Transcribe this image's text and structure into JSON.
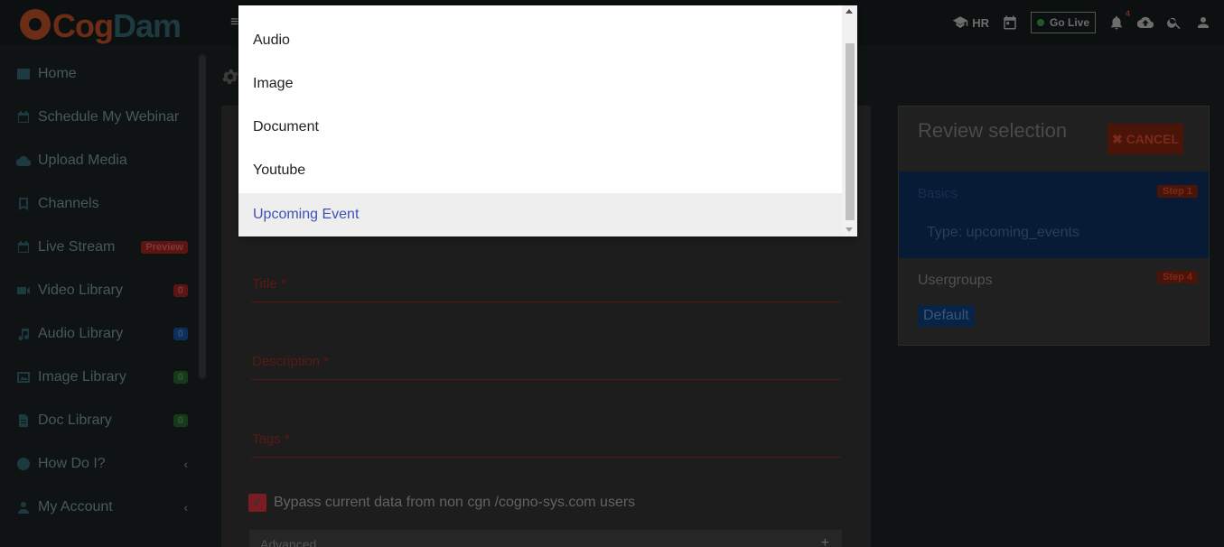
{
  "header": {
    "logo_text_a": "Cog",
    "logo_text_b": "Dam",
    "hr_label": "HR",
    "go_live_label": "Go Live",
    "notification_count": "4",
    "icons": [
      "graduation-cap-icon",
      "calendar-icon",
      "bell-icon",
      "cloud-upload-icon",
      "search-icon",
      "user-icon"
    ]
  },
  "sidebar": {
    "items": [
      {
        "label": "Home",
        "icon": "home-icon"
      },
      {
        "label": "Schedule My Webinar",
        "icon": "calendar-icon"
      },
      {
        "label": "Upload Media",
        "icon": "cloud-upload-icon"
      },
      {
        "label": "Channels",
        "icon": "bookmark-icon"
      },
      {
        "label": "Live Stream",
        "icon": "calendar-icon",
        "badge": "Preview"
      },
      {
        "label": "Video Library",
        "icon": "video-icon",
        "badge": "0"
      },
      {
        "label": "Audio Library",
        "icon": "music-icon",
        "badge": "0"
      },
      {
        "label": "Image Library",
        "icon": "image-icon",
        "badge": "0"
      },
      {
        "label": "Doc Library",
        "icon": "document-icon",
        "badge": "0"
      },
      {
        "label": "How Do I?",
        "icon": "help-icon"
      },
      {
        "label": "My Account",
        "icon": "user-icon"
      }
    ]
  },
  "form": {
    "title_label": "Title *",
    "description_label": "Description *",
    "tags_label": "Tags *",
    "bypass_label": "Bypass current data from non cgn /cogno-sys.com users",
    "bypass_checked": true,
    "advanced_label": "Advanced"
  },
  "review": {
    "title": "Review selection",
    "cancel_label": "CANCEL",
    "basics_label": "Basics",
    "basics_step": "Step 1",
    "basics_type": "Type: upcoming_events",
    "usergroups_label": "Usergroups",
    "usergroups_step": "Step 4",
    "usergroup_default": "Default"
  },
  "dropdown": {
    "options": [
      "Audio",
      "Image",
      "Document",
      "Youtube",
      "Upcoming Event"
    ],
    "selected": "Upcoming Event"
  },
  "colors": {
    "accent_selected": "#3f51b5",
    "danger": "#c62828",
    "primary": "#0d47a1"
  }
}
